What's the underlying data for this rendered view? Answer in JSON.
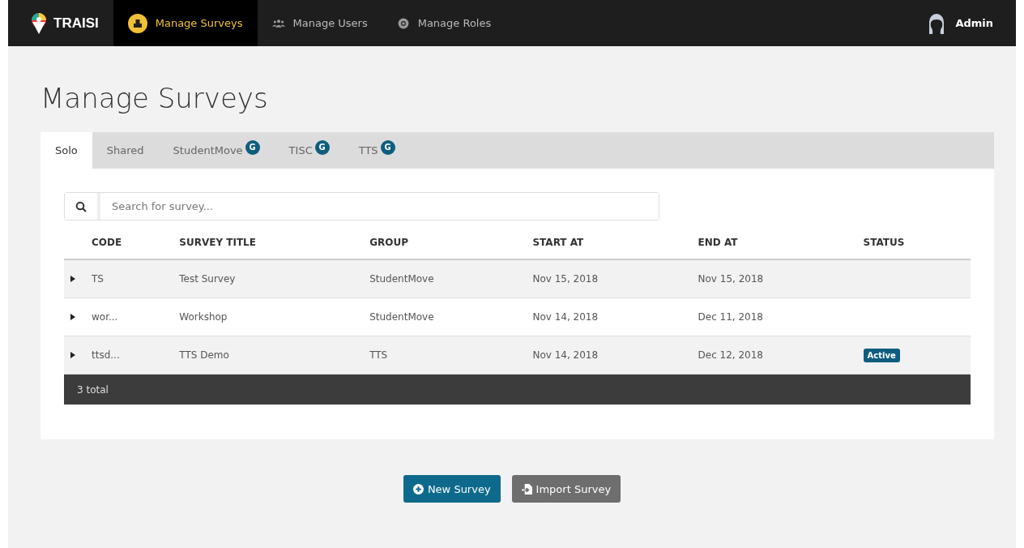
{
  "navbar": {
    "brand": "TRAISI",
    "items": [
      {
        "label": "Manage Surveys",
        "kind": "boxes",
        "selected": true
      },
      {
        "label": "Manage Users",
        "kind": "users",
        "selected": false
      },
      {
        "label": "Manage Roles",
        "kind": "roles",
        "selected": false
      }
    ],
    "user": "Admin"
  },
  "page_title": "Manage Surveys",
  "tabs": [
    {
      "label": "Solo",
      "selected": true
    },
    {
      "label": "Shared",
      "selected": false
    },
    {
      "label": "StudentMove",
      "badge": "G",
      "selected": false
    },
    {
      "label": "TISC",
      "badge": "G",
      "selected": false
    },
    {
      "label": "TTS",
      "badge": "G",
      "selected": false
    }
  ],
  "search": {
    "placeholder": "Search for survey..."
  },
  "table": {
    "columns": [
      "CODE",
      "SURVEY TITLE",
      "GROUP",
      "START AT",
      "END AT",
      "STATUS"
    ],
    "rows": [
      {
        "code": "TS",
        "title": "Test Survey",
        "group": "StudentMove",
        "start": "Nov 15, 2018",
        "end": "Nov 15, 2018"
      },
      {
        "code": "wor...",
        "title": "Workshop",
        "group": "StudentMove",
        "start": "Nov 14, 2018",
        "end": "Dec 11, 2018"
      },
      {
        "code": "ttsd...",
        "title": "TTS Demo",
        "group": "TTS",
        "start": "Nov 14, 2018",
        "end": "Dec 12, 2018",
        "status": "Active"
      }
    ],
    "footer": "3 total"
  },
  "buttons": [
    {
      "label": "New Survey",
      "kind": "primary"
    },
    {
      "label": "Import Survey",
      "kind": "secondary"
    }
  ]
}
